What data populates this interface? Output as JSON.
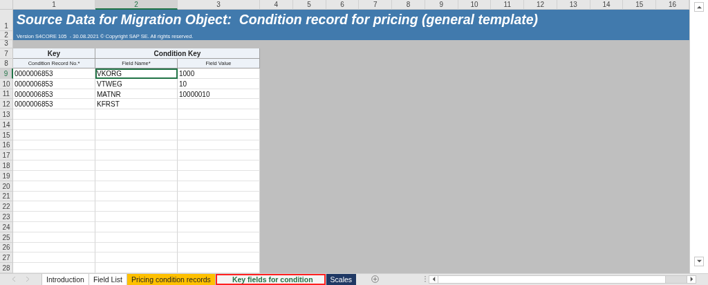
{
  "column_headers": [
    {
      "label": "1",
      "selected": false
    },
    {
      "label": "2",
      "selected": true
    },
    {
      "label": "3",
      "selected": false
    },
    {
      "label": "4",
      "selected": false
    },
    {
      "label": "5",
      "selected": false
    },
    {
      "label": "6",
      "selected": false
    },
    {
      "label": "7",
      "selected": false
    },
    {
      "label": "8",
      "selected": false
    },
    {
      "label": "9",
      "selected": false
    },
    {
      "label": "10",
      "selected": false
    },
    {
      "label": "11",
      "selected": false
    },
    {
      "label": "12",
      "selected": false
    },
    {
      "label": "13",
      "selected": false
    },
    {
      "label": "14",
      "selected": false
    },
    {
      "label": "15",
      "selected": false
    },
    {
      "label": "16",
      "selected": false
    }
  ],
  "banner": {
    "title_row": "1",
    "title": "Source Data for Migration Object:  Condition record for pricing (general template)",
    "version_row": "2",
    "version": "Version S4CORE 105  - 30.08.2021 © Copyright SAP SE. All rights reserved."
  },
  "spacer_row": "3",
  "group_header_row": {
    "row_number": "7",
    "labels": [
      "Key",
      "Condition Key"
    ]
  },
  "column_header_row": {
    "row_number": "8",
    "labels": [
      "Condition Record No.*",
      "Field Name*",
      "Field Value"
    ]
  },
  "data_rows": [
    {
      "row_number": "9",
      "cells": [
        {
          "text": "0000006853",
          "selected": false
        },
        {
          "text": "VKORG",
          "selected": true
        },
        {
          "text": "1000",
          "selected": false
        }
      ]
    },
    {
      "row_number": "10",
      "cells": [
        {
          "text": "0000006853",
          "selected": false
        },
        {
          "text": "VTWEG",
          "selected": false
        },
        {
          "text": "10",
          "selected": false
        }
      ]
    },
    {
      "row_number": "11",
      "cells": [
        {
          "text": "0000006853",
          "selected": false
        },
        {
          "text": "MATNR",
          "selected": false
        },
        {
          "text": "10000010",
          "selected": false
        }
      ]
    },
    {
      "row_number": "12",
      "cells": [
        {
          "text": "0000006853",
          "selected": false
        },
        {
          "text": "KFRST",
          "selected": false
        },
        {
          "text": null,
          "selected": false
        }
      ]
    }
  ],
  "empty_rows": [
    "13",
    "14",
    "15",
    "16",
    "17",
    "18",
    "19",
    "20",
    "21",
    "22",
    "23",
    "24",
    "25",
    "26",
    "27",
    "28"
  ],
  "sheet_tabs": [
    {
      "label": "Introduction",
      "color": "#ffffff",
      "selected": false,
      "highlighted": false
    },
    {
      "label": "Field List",
      "color": "#ffffff",
      "selected": false,
      "highlighted": false
    },
    {
      "label": "Pricing condition records",
      "color": "#ffc000",
      "selected": false,
      "highlighted": false
    },
    {
      "label": "Key fields for condition",
      "color": "#ffffff",
      "selected": true,
      "highlighted": true
    },
    {
      "label": "Scales",
      "color": "#1f3864",
      "selected": false,
      "highlighted": false
    }
  ]
}
